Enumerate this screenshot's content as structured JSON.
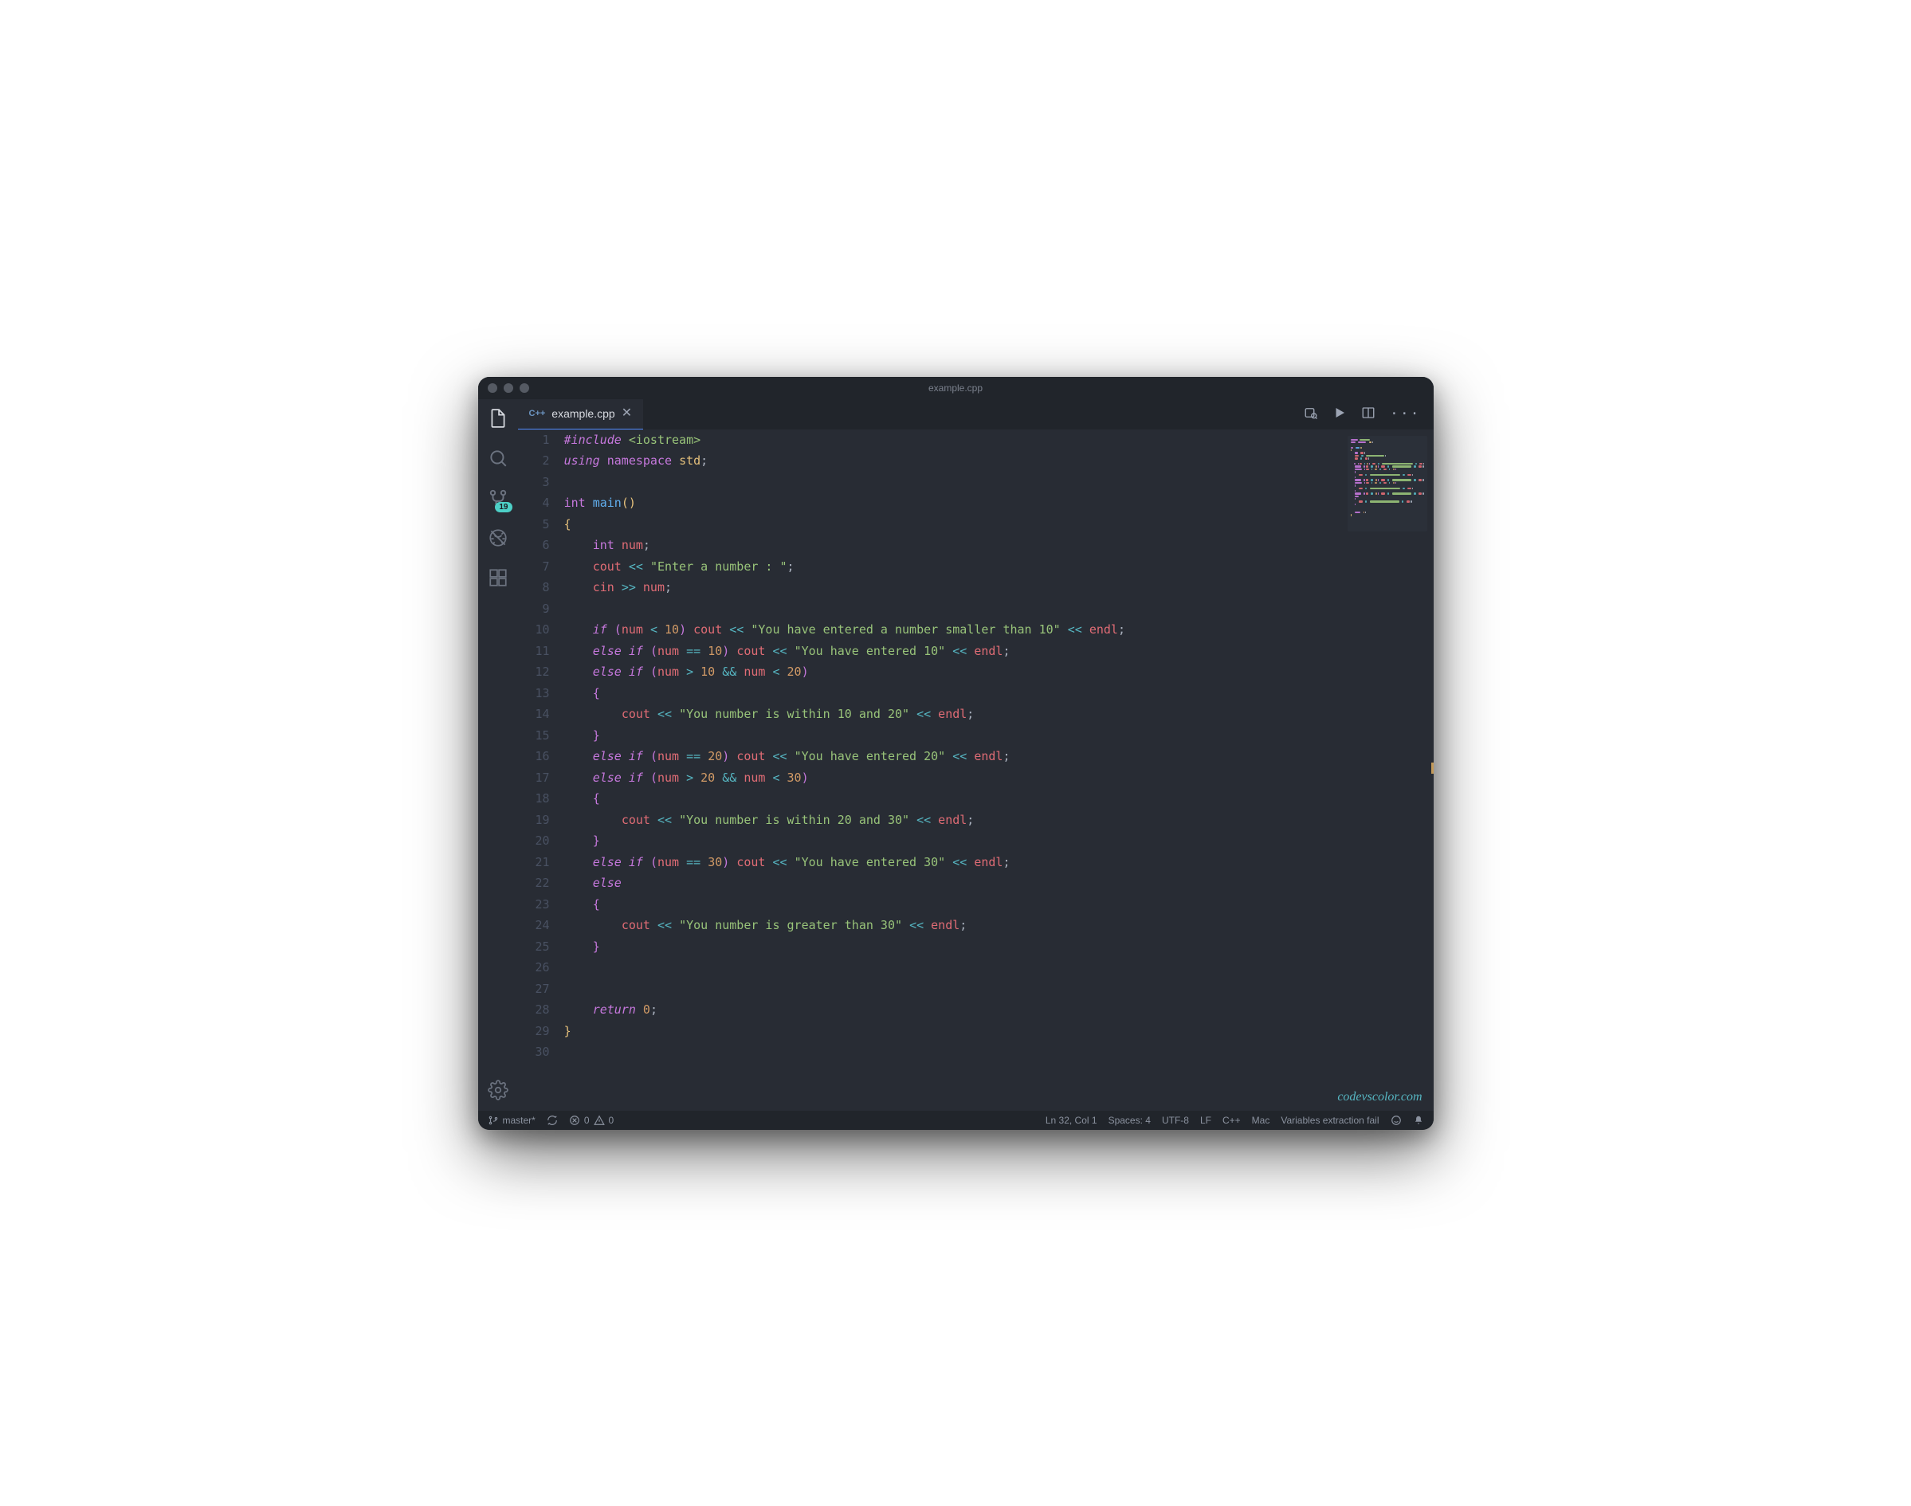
{
  "window": {
    "title": "example.cpp"
  },
  "tab": {
    "lang_badge": "C++",
    "filename": "example.cpp"
  },
  "activity": {
    "scm_badge": "19"
  },
  "code": {
    "lines": [
      [
        [
          "c-prep",
          "#include"
        ],
        [
          "",
          ""
        ],
        [
          "c-inc",
          " <iostream>"
        ]
      ],
      [
        [
          "c-kw",
          "using"
        ],
        [
          "",
          " "
        ],
        [
          "c-kw2",
          "namespace"
        ],
        [
          "",
          " "
        ],
        [
          "c-ns",
          "std"
        ],
        [
          "c-punc",
          ";"
        ]
      ],
      [
        [
          "",
          ""
        ]
      ],
      [
        [
          "c-type",
          "int"
        ],
        [
          "",
          " "
        ],
        [
          "c-fn",
          "main"
        ],
        [
          "c-brace",
          "()"
        ]
      ],
      [
        [
          "c-brace",
          "{"
        ]
      ],
      [
        [
          "",
          "    "
        ],
        [
          "c-type",
          "int"
        ],
        [
          "",
          " "
        ],
        [
          "c-var",
          "num"
        ],
        [
          "c-punc",
          ";"
        ]
      ],
      [
        [
          "",
          "    "
        ],
        [
          "c-obj",
          "cout"
        ],
        [
          "",
          " "
        ],
        [
          "c-op",
          "<<"
        ],
        [
          "",
          " "
        ],
        [
          "c-str",
          "\"Enter a number : \""
        ],
        [
          "c-punc",
          ";"
        ]
      ],
      [
        [
          "",
          "    "
        ],
        [
          "c-obj",
          "cin"
        ],
        [
          "",
          " "
        ],
        [
          "c-op",
          ">>"
        ],
        [
          "",
          " "
        ],
        [
          "c-var",
          "num"
        ],
        [
          "c-punc",
          ";"
        ]
      ],
      [
        [
          "",
          ""
        ]
      ],
      [
        [
          "",
          "    "
        ],
        [
          "c-kw",
          "if"
        ],
        [
          "",
          " "
        ],
        [
          "c-brace2",
          "("
        ],
        [
          "c-var",
          "num"
        ],
        [
          "",
          " "
        ],
        [
          "c-op",
          "<"
        ],
        [
          "",
          " "
        ],
        [
          "c-num",
          "10"
        ],
        [
          "c-brace2",
          ")"
        ],
        [
          "",
          " "
        ],
        [
          "c-obj",
          "cout"
        ],
        [
          "",
          " "
        ],
        [
          "c-op",
          "<<"
        ],
        [
          "",
          " "
        ],
        [
          "c-str",
          "\"You have entered a number smaller than 10\""
        ],
        [
          "",
          " "
        ],
        [
          "c-op",
          "<<"
        ],
        [
          "",
          " "
        ],
        [
          "c-var",
          "endl"
        ],
        [
          "c-punc",
          ";"
        ]
      ],
      [
        [
          "",
          "    "
        ],
        [
          "c-kw",
          "else if"
        ],
        [
          "",
          " "
        ],
        [
          "c-brace2",
          "("
        ],
        [
          "c-var",
          "num"
        ],
        [
          "",
          " "
        ],
        [
          "c-op",
          "=="
        ],
        [
          "",
          " "
        ],
        [
          "c-num",
          "10"
        ],
        [
          "c-brace2",
          ")"
        ],
        [
          "",
          " "
        ],
        [
          "c-obj",
          "cout"
        ],
        [
          "",
          " "
        ],
        [
          "c-op",
          "<<"
        ],
        [
          "",
          " "
        ],
        [
          "c-str",
          "\"You have entered 10\""
        ],
        [
          "",
          " "
        ],
        [
          "c-op",
          "<<"
        ],
        [
          "",
          " "
        ],
        [
          "c-var",
          "endl"
        ],
        [
          "c-punc",
          ";"
        ]
      ],
      [
        [
          "",
          "    "
        ],
        [
          "c-kw",
          "else if"
        ],
        [
          "",
          " "
        ],
        [
          "c-brace2",
          "("
        ],
        [
          "c-var",
          "num"
        ],
        [
          "",
          " "
        ],
        [
          "c-op",
          ">"
        ],
        [
          "",
          " "
        ],
        [
          "c-num",
          "10"
        ],
        [
          "",
          " "
        ],
        [
          "c-op",
          "&&"
        ],
        [
          "",
          " "
        ],
        [
          "c-var",
          "num"
        ],
        [
          "",
          " "
        ],
        [
          "c-op",
          "<"
        ],
        [
          "",
          " "
        ],
        [
          "c-num",
          "20"
        ],
        [
          "c-brace2",
          ")"
        ]
      ],
      [
        [
          "",
          "    "
        ],
        [
          "c-brace2",
          "{"
        ]
      ],
      [
        [
          "",
          "        "
        ],
        [
          "c-obj",
          "cout"
        ],
        [
          "",
          " "
        ],
        [
          "c-op",
          "<<"
        ],
        [
          "",
          " "
        ],
        [
          "c-str",
          "\"You number is within 10 and 20\""
        ],
        [
          "",
          " "
        ],
        [
          "c-op",
          "<<"
        ],
        [
          "",
          " "
        ],
        [
          "c-var",
          "endl"
        ],
        [
          "c-punc",
          ";"
        ]
      ],
      [
        [
          "",
          "    "
        ],
        [
          "c-brace2",
          "}"
        ]
      ],
      [
        [
          "",
          "    "
        ],
        [
          "c-kw",
          "else if"
        ],
        [
          "",
          " "
        ],
        [
          "c-brace2",
          "("
        ],
        [
          "c-var",
          "num"
        ],
        [
          "",
          " "
        ],
        [
          "c-op",
          "=="
        ],
        [
          "",
          " "
        ],
        [
          "c-num",
          "20"
        ],
        [
          "c-brace2",
          ")"
        ],
        [
          "",
          " "
        ],
        [
          "c-obj",
          "cout"
        ],
        [
          "",
          " "
        ],
        [
          "c-op",
          "<<"
        ],
        [
          "",
          " "
        ],
        [
          "c-str",
          "\"You have entered 20\""
        ],
        [
          "",
          " "
        ],
        [
          "c-op",
          "<<"
        ],
        [
          "",
          " "
        ],
        [
          "c-var",
          "endl"
        ],
        [
          "c-punc",
          ";"
        ]
      ],
      [
        [
          "",
          "    "
        ],
        [
          "c-kw",
          "else if"
        ],
        [
          "",
          " "
        ],
        [
          "c-brace2",
          "("
        ],
        [
          "c-var",
          "num"
        ],
        [
          "",
          " "
        ],
        [
          "c-op",
          ">"
        ],
        [
          "",
          " "
        ],
        [
          "c-num",
          "20"
        ],
        [
          "",
          " "
        ],
        [
          "c-op",
          "&&"
        ],
        [
          "",
          " "
        ],
        [
          "c-var",
          "num"
        ],
        [
          "",
          " "
        ],
        [
          "c-op",
          "<"
        ],
        [
          "",
          " "
        ],
        [
          "c-num",
          "30"
        ],
        [
          "c-brace2",
          ")"
        ]
      ],
      [
        [
          "",
          "    "
        ],
        [
          "c-brace2",
          "{"
        ]
      ],
      [
        [
          "",
          "        "
        ],
        [
          "c-obj",
          "cout"
        ],
        [
          "",
          " "
        ],
        [
          "c-op",
          "<<"
        ],
        [
          "",
          " "
        ],
        [
          "c-str",
          "\"You number is within 20 and 30\""
        ],
        [
          "",
          " "
        ],
        [
          "c-op",
          "<<"
        ],
        [
          "",
          " "
        ],
        [
          "c-var",
          "endl"
        ],
        [
          "c-punc",
          ";"
        ]
      ],
      [
        [
          "",
          "    "
        ],
        [
          "c-brace2",
          "}"
        ]
      ],
      [
        [
          "",
          "    "
        ],
        [
          "c-kw",
          "else if"
        ],
        [
          "",
          " "
        ],
        [
          "c-brace2",
          "("
        ],
        [
          "c-var",
          "num"
        ],
        [
          "",
          " "
        ],
        [
          "c-op",
          "=="
        ],
        [
          "",
          " "
        ],
        [
          "c-num",
          "30"
        ],
        [
          "c-brace2",
          ")"
        ],
        [
          "",
          " "
        ],
        [
          "c-obj",
          "cout"
        ],
        [
          "",
          " "
        ],
        [
          "c-op",
          "<<"
        ],
        [
          "",
          " "
        ],
        [
          "c-str",
          "\"You have entered 30\""
        ],
        [
          "",
          " "
        ],
        [
          "c-op",
          "<<"
        ],
        [
          "",
          " "
        ],
        [
          "c-var",
          "endl"
        ],
        [
          "c-punc",
          ";"
        ]
      ],
      [
        [
          "",
          "    "
        ],
        [
          "c-kw",
          "else"
        ]
      ],
      [
        [
          "",
          "    "
        ],
        [
          "c-brace2",
          "{"
        ]
      ],
      [
        [
          "",
          "        "
        ],
        [
          "c-obj",
          "cout"
        ],
        [
          "",
          " "
        ],
        [
          "c-op",
          "<<"
        ],
        [
          "",
          " "
        ],
        [
          "c-str",
          "\"You number is greater than 30\""
        ],
        [
          "",
          " "
        ],
        [
          "c-op",
          "<<"
        ],
        [
          "",
          " "
        ],
        [
          "c-var",
          "endl"
        ],
        [
          "c-punc",
          ";"
        ]
      ],
      [
        [
          "",
          "    "
        ],
        [
          "c-brace2",
          "}"
        ]
      ],
      [
        [
          "",
          ""
        ]
      ],
      [
        [
          "",
          ""
        ]
      ],
      [
        [
          "",
          "    "
        ],
        [
          "c-kw",
          "return"
        ],
        [
          "",
          " "
        ],
        [
          "c-num",
          "0"
        ],
        [
          "c-punc",
          ";"
        ]
      ],
      [
        [
          "c-brace",
          "}"
        ]
      ],
      [
        [
          "",
          ""
        ]
      ]
    ]
  },
  "watermark": "codevscolor.com",
  "status": {
    "branch": "master*",
    "errors": "0",
    "warnings": "0",
    "cursor": "Ln 32, Col 1",
    "spaces": "Spaces: 4",
    "encoding": "UTF-8",
    "eol": "LF",
    "lang": "C++",
    "os": "Mac",
    "message": "Variables extraction fail"
  }
}
